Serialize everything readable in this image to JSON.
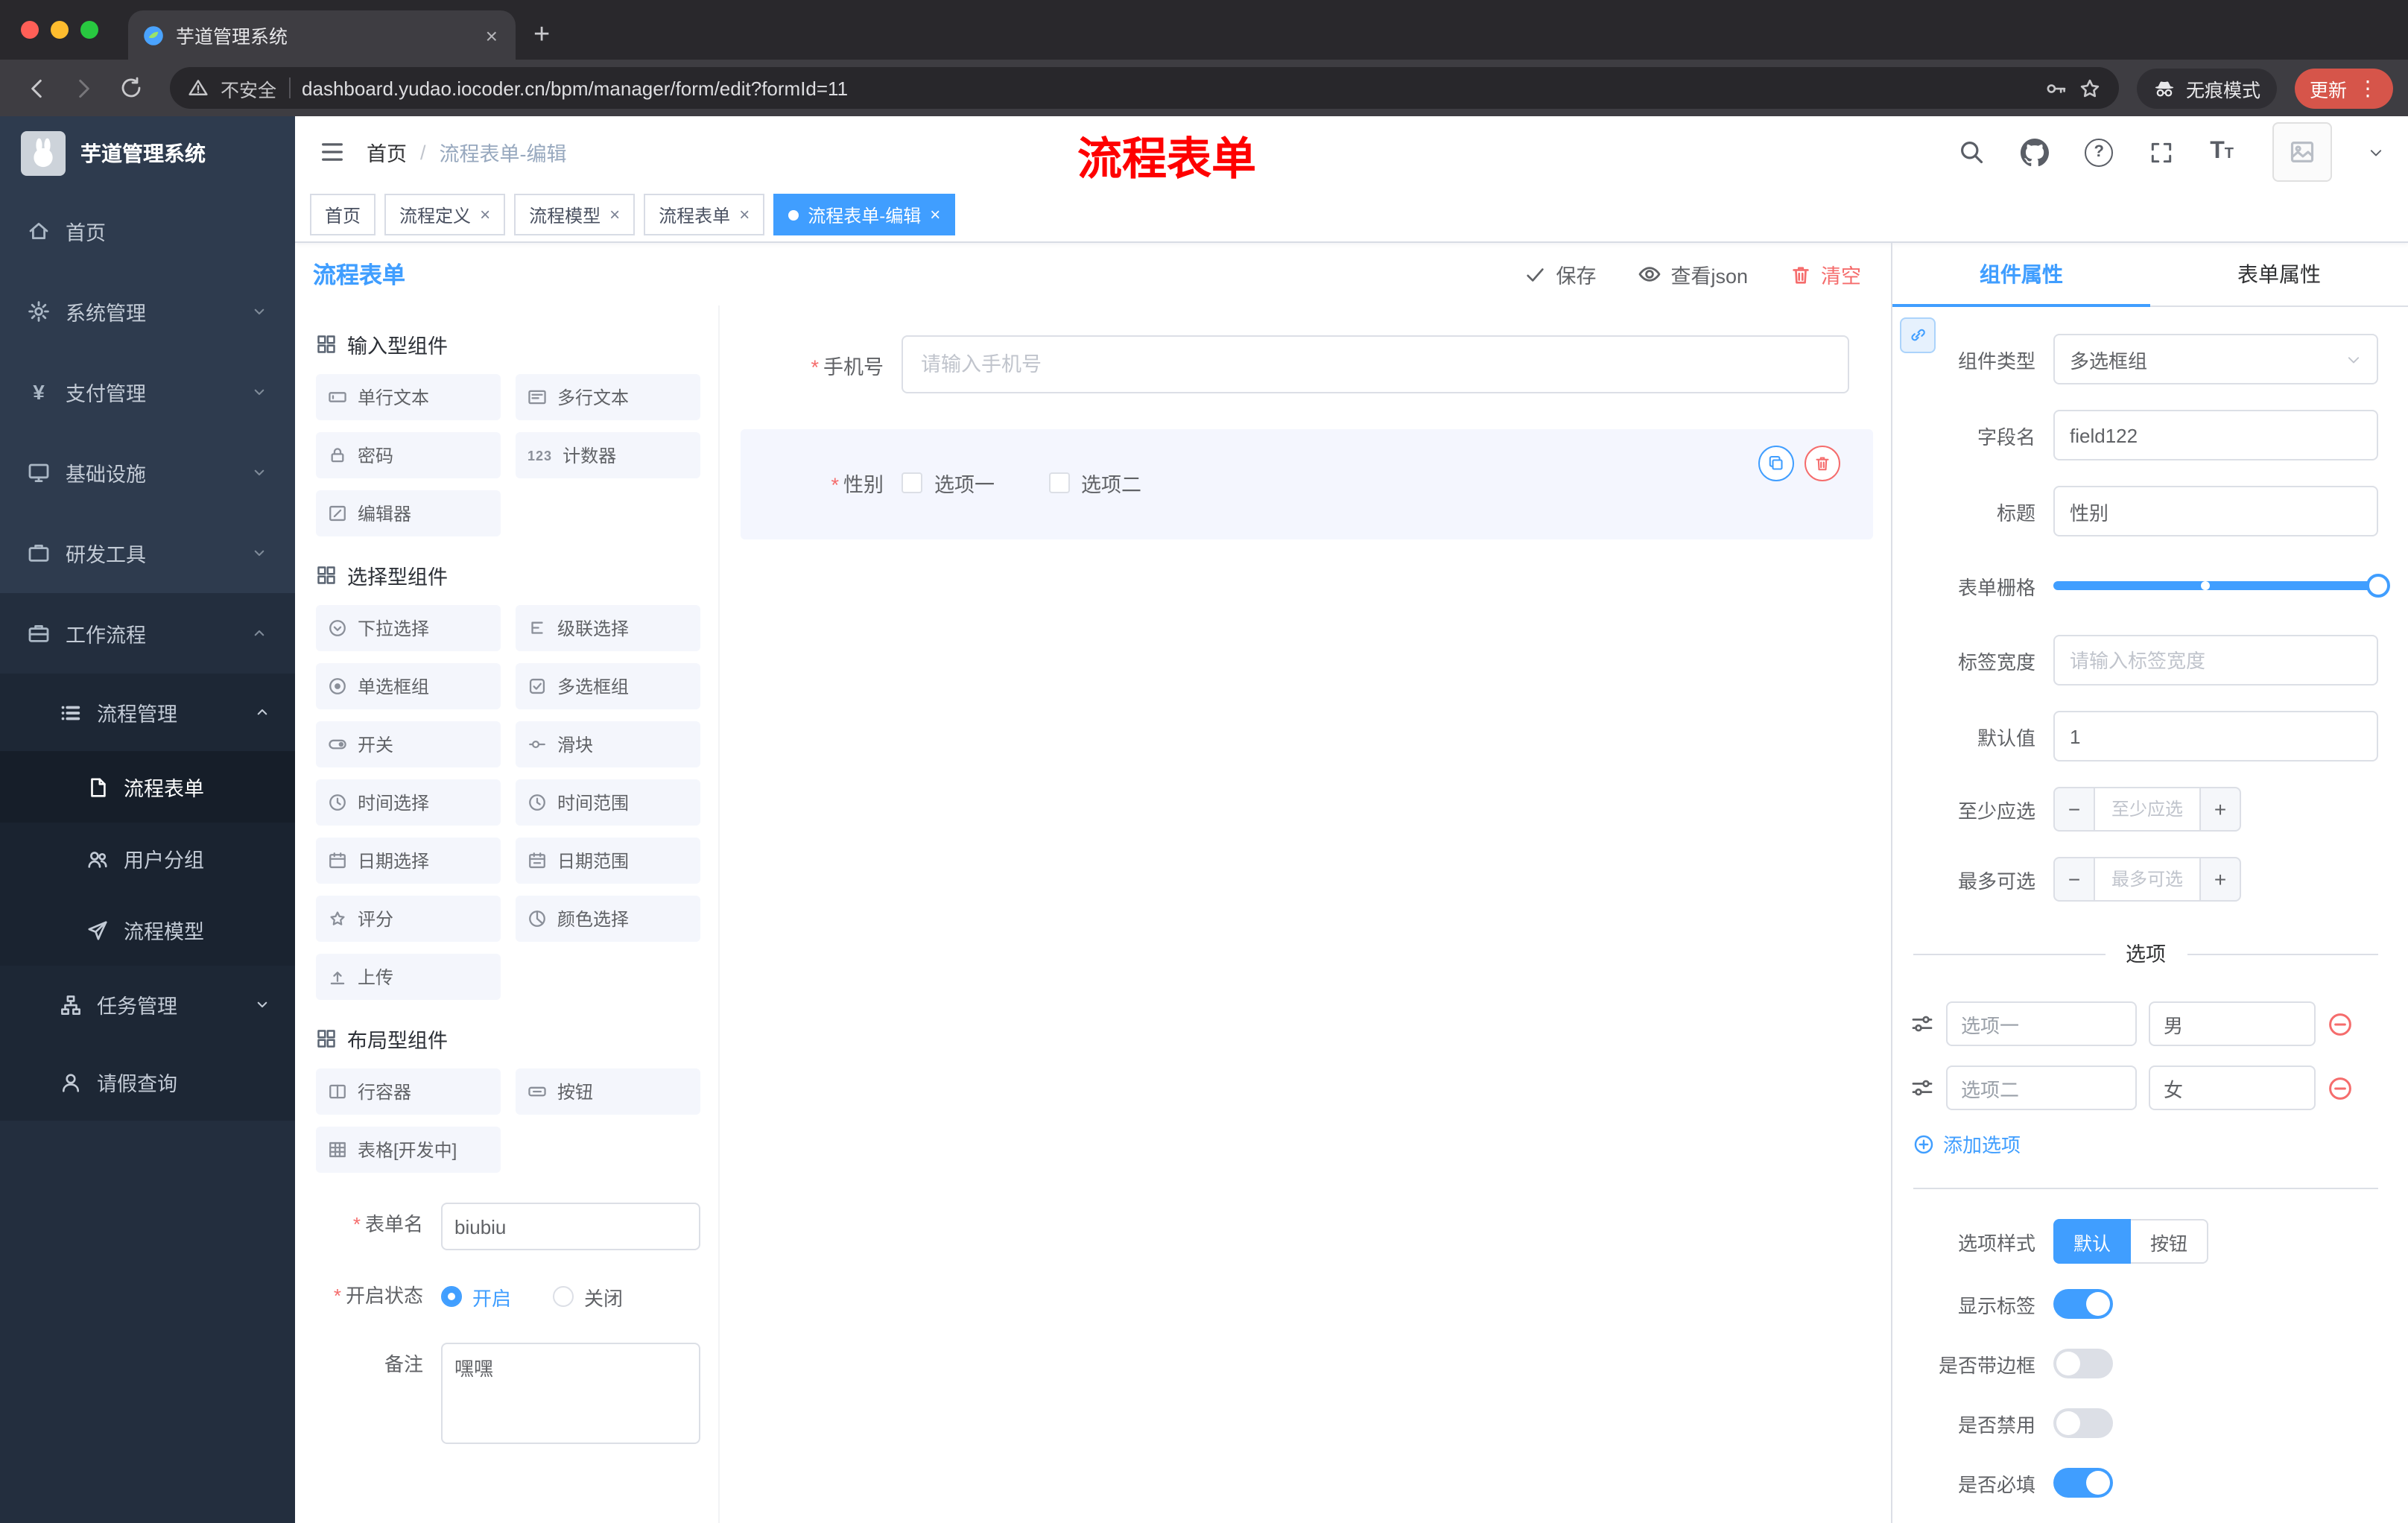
{
  "browser": {
    "tab_title": "芋道管理系统",
    "security_label": "不安全",
    "url": "dashboard.yudao.iocoder.cn/bpm/manager/form/edit?formId=11",
    "incognito_label": "无痕模式",
    "update_label": "更新"
  },
  "sidebar": {
    "logo_title": "芋道管理系统",
    "items": [
      {
        "label": "首页",
        "icon": "home"
      },
      {
        "label": "系统管理",
        "icon": "gear"
      },
      {
        "label": "支付管理",
        "icon": "yen"
      },
      {
        "label": "基础设施",
        "icon": "monitor"
      },
      {
        "label": "研发工具",
        "icon": "toolbox"
      },
      {
        "label": "工作流程",
        "icon": "briefcase"
      }
    ],
    "submenu": {
      "process_mgmt": {
        "label": "流程管理",
        "children": [
          {
            "label": "流程表单",
            "icon": "document",
            "active": true
          },
          {
            "label": "用户分组",
            "icon": "users"
          },
          {
            "label": "流程模型",
            "icon": "send"
          }
        ]
      },
      "task_mgmt": {
        "label": "任务管理",
        "icon": "tree"
      },
      "leave_query": {
        "label": "请假查询",
        "icon": "user"
      }
    }
  },
  "header": {
    "breadcrumb_home": "首页",
    "breadcrumb_current": "流程表单-编辑",
    "annotation": "流程表单"
  },
  "tags": [
    {
      "label": "首页",
      "closable": false,
      "active": false
    },
    {
      "label": "流程定义",
      "closable": true,
      "active": false
    },
    {
      "label": "流程模型",
      "closable": true,
      "active": false
    },
    {
      "label": "流程表单",
      "closable": true,
      "active": false
    },
    {
      "label": "流程表单-编辑",
      "closable": true,
      "active": true
    }
  ],
  "designer": {
    "title": "流程表单",
    "save": "保存",
    "view_json": "查看json",
    "clear": "清空",
    "sections": [
      {
        "title": "输入型组件",
        "items": [
          "单行文本",
          "多行文本",
          "密码",
          "计数器",
          "编辑器"
        ]
      },
      {
        "title": "选择型组件",
        "items": [
          "下拉选择",
          "级联选择",
          "单选框组",
          "多选框组",
          "开关",
          "滑块",
          "时间选择",
          "时间范围",
          "日期选择",
          "日期范围",
          "评分",
          "颜色选择",
          "上传"
        ]
      },
      {
        "title": "布局型组件",
        "items": [
          "行容器",
          "按钮",
          "表格[开发中]"
        ]
      }
    ],
    "meta": {
      "name_label": "表单名",
      "name_value": "biubiu",
      "status_label": "开启状态",
      "on_label": "开启",
      "off_label": "关闭",
      "remark_label": "备注",
      "remark_value": "嘿嘿"
    },
    "canvas": {
      "phone_label": "手机号",
      "phone_placeholder": "请输入手机号",
      "gender_label": "性别",
      "opt1": "选项一",
      "opt2": "选项二"
    }
  },
  "props": {
    "tab_component": "组件属性",
    "tab_form": "表单属性",
    "rows": {
      "type_label": "组件类型",
      "type_value": "多选框组",
      "field_label": "字段名",
      "field_value": "field122",
      "title_label": "标题",
      "title_value": "性别",
      "grid_label": "表单栅格",
      "width_label": "标签宽度",
      "width_placeholder": "请输入标签宽度",
      "default_label": "默认值",
      "default_value": "1",
      "min_label": "至少应选",
      "min_placeholder": "至少应选",
      "max_label": "最多可选",
      "max_placeholder": "最多可选"
    },
    "options_title": "选项",
    "options": [
      {
        "label": "选项一",
        "value": "男"
      },
      {
        "label": "选项二",
        "value": "女"
      }
    ],
    "add_option": "添加选项",
    "style_label": "选项样式",
    "style_options": [
      "默认",
      "按钮"
    ],
    "toggles": [
      {
        "label": "显示标签",
        "on": true
      },
      {
        "label": "是否带边框",
        "on": false
      },
      {
        "label": "是否禁用",
        "on": false
      },
      {
        "label": "是否必填",
        "on": true
      }
    ]
  },
  "colors": {
    "primary": "#409eff",
    "danger": "#f56c6c",
    "update_badge": "#d6554a"
  }
}
